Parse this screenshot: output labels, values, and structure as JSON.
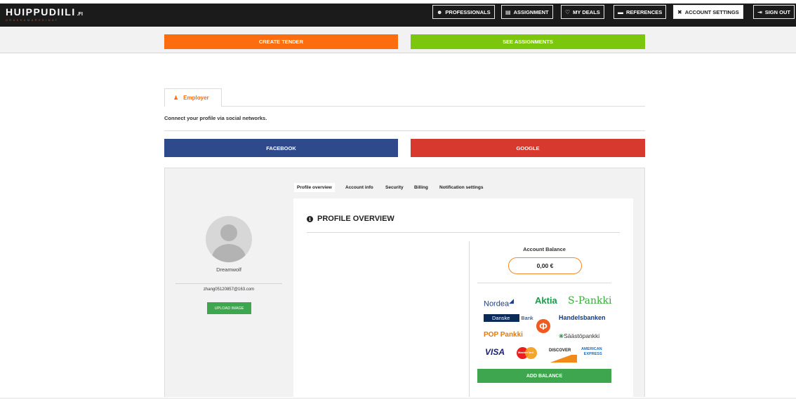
{
  "header": {
    "logo": "HUIPPUDIILI",
    "logo_suffix": ".FI",
    "logo_tagline": "URAKKAMARKKINAT",
    "nav": [
      {
        "label": "PROFESSIONALS",
        "icon": "users-icon"
      },
      {
        "label": "ASSIGNMENT",
        "icon": "document-icon"
      },
      {
        "label": "MY DEALS",
        "icon": "handshake-icon"
      },
      {
        "label": "REFERENCES",
        "icon": "folder-icon"
      },
      {
        "label": "ACCOUNT SETTINGS",
        "icon": "tools-icon",
        "active": true
      },
      {
        "label": "SIGN OUT",
        "icon": "sign-out-icon"
      }
    ]
  },
  "actions": {
    "create_tender": "CREATE TENDER",
    "see_assignments": "SEE ASSIGNMENTS"
  },
  "role_tab": {
    "label": "Employer",
    "icon": "user-icon"
  },
  "social": {
    "connect_text": "Connect your profile via social networks.",
    "facebook": "FACEBOOK",
    "google": "GOOGLE"
  },
  "profile": {
    "username": "Dreamwolf",
    "email": "zhang05120857@163.com",
    "upload_label": "UPLOAD IMAGE"
  },
  "subtabs": [
    "Profile overview",
    "Account info",
    "Security",
    "Billing",
    "Notification settings"
  ],
  "overview": {
    "title": "PROFILE OVERVIEW",
    "balance_label": "Account Balance",
    "balance_value": "0,00 €",
    "add_balance": "ADD BALANCE",
    "payment_logos": {
      "nordea": "Nordea",
      "aktia": "Aktia",
      "spankki": "S-Pankki",
      "danske": "Danske",
      "danske_bank": "Bank",
      "handelsbanken": "Handelsbanken",
      "pop": "POP Pankki",
      "saastopankki": "Säästöpankki",
      "visa": "VISA",
      "mastercard": "MasterCard",
      "discover": "DISCOVER",
      "amex_1": "AMERICAN",
      "amex_2": "EXPRESS"
    }
  },
  "colors": {
    "orange": "#fb6d0f",
    "green": "#7ac70e",
    "facebook": "#2f4a8a",
    "google": "#d8392f",
    "button_green": "#3ea64f"
  }
}
